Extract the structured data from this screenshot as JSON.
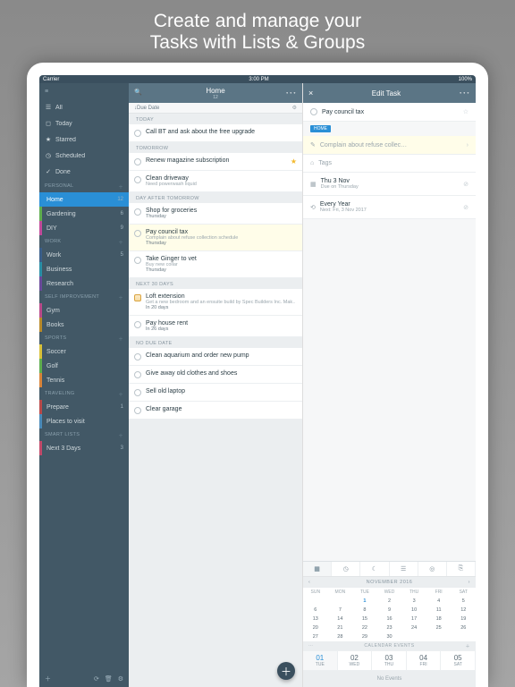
{
  "promo": {
    "l1": "Create and manage your",
    "l2a": "Tasks",
    "l2b": " with ",
    "l2c": "Lists",
    "l2d": " & ",
    "l2e": "Groups"
  },
  "status": {
    "carrier": "Carrier",
    "wifi": "⌃",
    "time": "3:00 PM",
    "batt": "100%"
  },
  "sidebar": {
    "smart": [
      {
        "icon": "☰",
        "label": "All",
        "count": ""
      },
      {
        "icon": "◻",
        "label": "Today",
        "count": ""
      },
      {
        "icon": "★",
        "label": "Starred",
        "count": ""
      },
      {
        "icon": "◷",
        "label": "Scheduled",
        "count": ""
      },
      {
        "icon": "✓",
        "label": "Done",
        "count": ""
      }
    ],
    "groups": [
      {
        "name": "PERSONAL",
        "items": [
          {
            "color": "#2a8fd6",
            "label": "Home",
            "count": "12",
            "sel": true
          },
          {
            "color": "#5fae4e",
            "label": "Gardening",
            "count": "6"
          },
          {
            "color": "#c24a9a",
            "label": "DIY",
            "count": "9"
          }
        ]
      },
      {
        "name": "WORK",
        "items": [
          {
            "color": "#3a5f8a",
            "label": "Work",
            "count": "5"
          },
          {
            "color": "#2a8fa6",
            "label": "Business",
            "count": ""
          },
          {
            "color": "#6a4a9a",
            "label": "Research",
            "count": ""
          }
        ]
      },
      {
        "name": "SELF IMPROVEMENT",
        "items": [
          {
            "color": "#b94a8a",
            "label": "Gym",
            "count": ""
          },
          {
            "color": "#b98a2a",
            "label": "Books",
            "count": ""
          }
        ]
      },
      {
        "name": "SPORTS",
        "items": [
          {
            "color": "#d9c23a",
            "label": "Soccer",
            "count": ""
          },
          {
            "color": "#5fae4e",
            "label": "Golf",
            "count": ""
          },
          {
            "color": "#d9843a",
            "label": "Tennis",
            "count": ""
          }
        ]
      },
      {
        "name": "TRAVELING",
        "items": [
          {
            "color": "#b94a4a",
            "label": "Prepare",
            "count": "1"
          },
          {
            "color": "#4a8ab9",
            "label": "Places to visit",
            "count": ""
          }
        ]
      },
      {
        "name": "SMART LISTS",
        "items": [
          {
            "color": "#c24a6a",
            "label": "Next 3 Days",
            "count": "3"
          }
        ]
      }
    ]
  },
  "main": {
    "title": "Home",
    "subtitle": "12",
    "sort": "↓Due Date",
    "sections": [
      {
        "head": "TODAY",
        "tasks": [
          {
            "t": "Call BT and ask about the free upgrade"
          }
        ]
      },
      {
        "head": "TOMORROW",
        "tasks": [
          {
            "t": "Renew magazine subscription",
            "star": true
          },
          {
            "t": "Clean driveway",
            "n": "Need powerwash liquid"
          }
        ]
      },
      {
        "head": "DAY AFTER TOMORROW",
        "tasks": [
          {
            "t": "Shop for groceries",
            "d": "Thursday"
          },
          {
            "t": "Pay council tax",
            "n": "Complain about refuse collection schedule",
            "d": "Thursday",
            "sel": true
          },
          {
            "t": "Take Ginger to vet",
            "n": "Buy new collar",
            "d": "Thursday"
          }
        ]
      },
      {
        "head": "NEXT 30 DAYS",
        "tasks": [
          {
            "t": "Loft extension",
            "n": "Get a new bedroom and an ensuite build by Spec Builders Inc. Mak…",
            "d": "In 20 days",
            "proj": true
          },
          {
            "t": "Pay house rent",
            "d": "In 26 days"
          }
        ]
      },
      {
        "head": "NO DUE DATE",
        "tasks": [
          {
            "t": "Clean aquarium and order new pump"
          },
          {
            "t": "Give away old clothes and shoes"
          },
          {
            "t": "Sell old laptop"
          },
          {
            "t": "Clear garage"
          }
        ]
      }
    ]
  },
  "edit": {
    "title": "Edit Task",
    "task": "Pay council tax",
    "listTag": "HOME",
    "note": "Complain about refuse collec…",
    "tags": "Tags",
    "due": {
      "label": "Thu 3 Nov",
      "sub": "Due on Thursday"
    },
    "repeat": {
      "label": "Every Year",
      "sub": "Next: Fri, 3 Nov 2017"
    },
    "cal": {
      "month": "NOVEMBER 2016",
      "dow": [
        "SUN",
        "MON",
        "TUE",
        "WED",
        "THU",
        "FRI",
        "SAT"
      ],
      "weeks": [
        [
          "",
          "",
          "1",
          "2",
          "3",
          "4",
          "5"
        ],
        [
          "6",
          "7",
          "8",
          "9",
          "10",
          "11",
          "12"
        ],
        [
          "13",
          "14",
          "15",
          "16",
          "17",
          "18",
          "19"
        ],
        [
          "20",
          "21",
          "22",
          "23",
          "24",
          "25",
          "26"
        ],
        [
          "27",
          "28",
          "29",
          "30",
          "",
          "",
          ""
        ]
      ],
      "events": "CALENDAR EVENTS",
      "days": [
        {
          "n": "01",
          "d": "TUE"
        },
        {
          "n": "02",
          "d": "WED"
        },
        {
          "n": "03",
          "d": "THU"
        },
        {
          "n": "04",
          "d": "FRI"
        },
        {
          "n": "05",
          "d": "SAT"
        }
      ],
      "noev": "No Events"
    }
  }
}
